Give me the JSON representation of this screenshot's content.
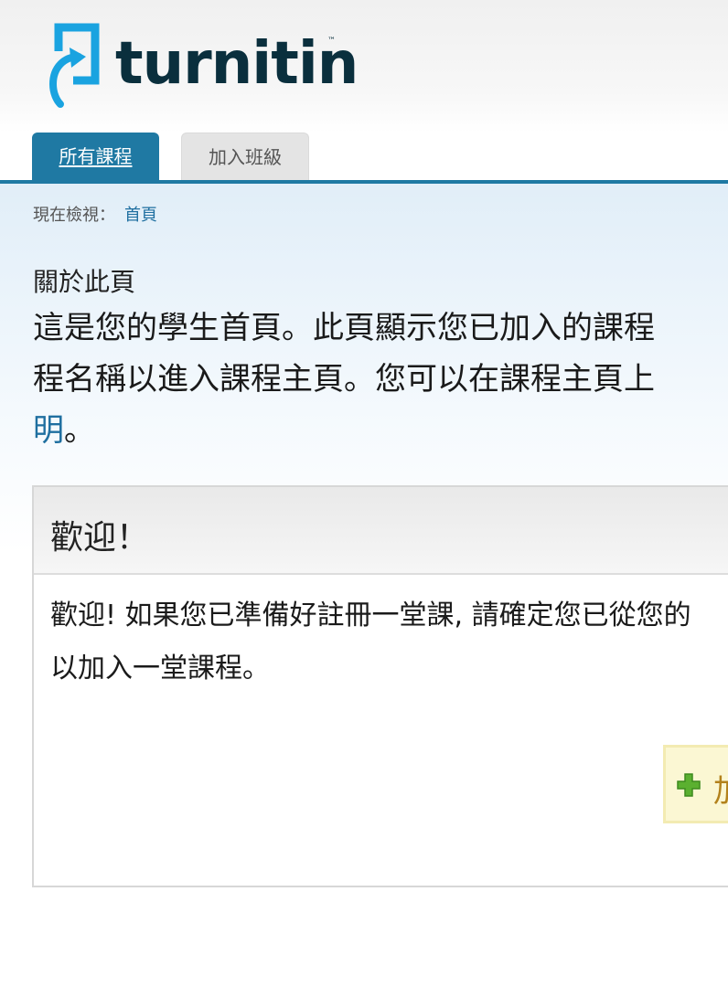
{
  "brand": {
    "name": "turnitin",
    "trademark": "™",
    "colors": {
      "brand_blue": "#1f79a3",
      "logo_mark": "#1aa3e0",
      "logo_text": "#0a2f3d",
      "link": "#1f6fa0"
    }
  },
  "tabs": [
    {
      "label": "所有課程",
      "active": true
    },
    {
      "label": "加入班級",
      "active": false
    }
  ],
  "breadcrumb": {
    "prefix": "現在檢視：",
    "current": "首頁"
  },
  "about": {
    "label": "關於此頁",
    "lines": [
      "這是您的學生首頁。此頁顯示您已加入的課程",
      "程名稱以進入課程主頁。您可以在課程主頁上"
    ],
    "link_text": "明",
    "tail": "。"
  },
  "welcome": {
    "title": "歡迎！",
    "lines": [
      "歡迎! 如果您已準備好註冊一堂課, 請確定您已從您的",
      "以加入一堂課程。"
    ],
    "join_button": {
      "icon": "plus-icon",
      "label": "加"
    }
  }
}
